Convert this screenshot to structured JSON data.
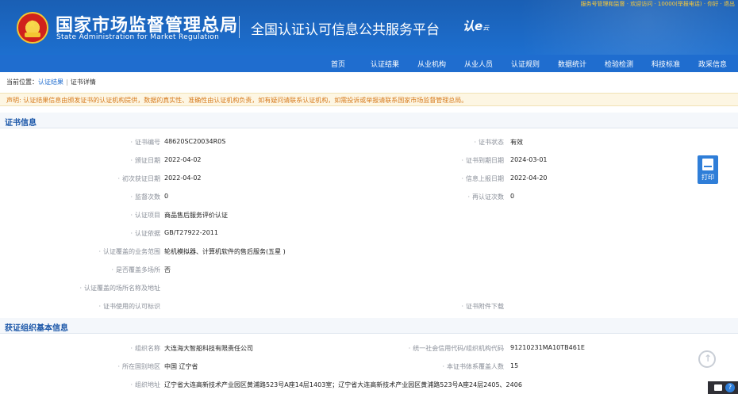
{
  "header": {
    "topline": "服务号管理和监督 · 欢迎访问 · 10000(举报电话) · 你好 · 退出",
    "org_name_cn": "国家市场监督管理总局",
    "org_name_en": "State Administration  for  Market Regulation",
    "platform_title": "全国认证认可信息公共服务平台",
    "brand_main": "认e",
    "brand_sub": "云"
  },
  "nav": {
    "items": [
      {
        "label": "首页"
      },
      {
        "label": "认证结果"
      },
      {
        "label": "从业机构"
      },
      {
        "label": "从业人员"
      },
      {
        "label": "认证规则"
      },
      {
        "label": "数据统计"
      },
      {
        "label": "检验检测"
      },
      {
        "label": "科技标准"
      },
      {
        "label": "政采信息"
      }
    ]
  },
  "breadcrumb": {
    "prefix": "当前位置：",
    "items": [
      "认证结果",
      "证书详情"
    ],
    "separator": "|"
  },
  "notice": "声明: 认证结果信息由颁发证书的认证机构提供，数据的真实性、准确性由认证机构负责，如有疑问请联系认证机构，如需投诉或举报请联系国家市场监督管理总局。",
  "cert_section": {
    "title": "证书信息",
    "fields": [
      {
        "label": "证书编号",
        "value": "48620SC20034R0S"
      },
      {
        "label": "证书状态",
        "value": "有效"
      },
      {
        "label": "颁证日期",
        "value": "2022-04-02"
      },
      {
        "label": "证书到期日期",
        "value": "2024-03-01"
      },
      {
        "label": "初次获证日期",
        "value": "2022-04-02"
      },
      {
        "label": "信息上报日期",
        "value": "2022-04-20"
      },
      {
        "label": "监督次数",
        "value": "0"
      },
      {
        "label": "再认证次数",
        "value": "0"
      },
      {
        "label": "认证项目",
        "value": "商品售后服务评价认证"
      },
      {
        "label": "认证依据",
        "value": "GB/T27922-2011"
      },
      {
        "label": "认证覆盖的业务范围",
        "value": "轮机模拟器、计算机软件的售后服务(五星 )"
      },
      {
        "label": "是否覆盖多场所",
        "value": "否"
      },
      {
        "label": "认证覆盖的场所名称及地址",
        "value": ""
      },
      {
        "label": "证书使用的认可标识",
        "value": ""
      },
      {
        "label": "证书附件下载",
        "value": ""
      }
    ]
  },
  "org_section": {
    "title": "获证组织基本信息",
    "fields": [
      {
        "label": "组织名称",
        "value": "大连海大智船科技有限责任公司"
      },
      {
        "label": "统一社会信用代码/组织机构代码",
        "value": "91210231MA10TB461E"
      },
      {
        "label": "所在国别地区",
        "value": "中国 辽宁省"
      },
      {
        "label": "本证书体系覆盖人数",
        "value": "15"
      },
      {
        "label": "组织地址",
        "value": "辽宁省大连高新技术产业园区黄浦路523号A座14层1403室；辽宁省大连高新技术产业园区黄浦路523号A座24层2405、2406"
      }
    ]
  },
  "controls": {
    "print_label": "打印",
    "chat_help": "?"
  },
  "colors": {
    "header_blue": "#1a5fb4",
    "nav_blue": "#1f6dcf",
    "section_title": "#1a56a8",
    "notice_text": "#d67a1c"
  }
}
